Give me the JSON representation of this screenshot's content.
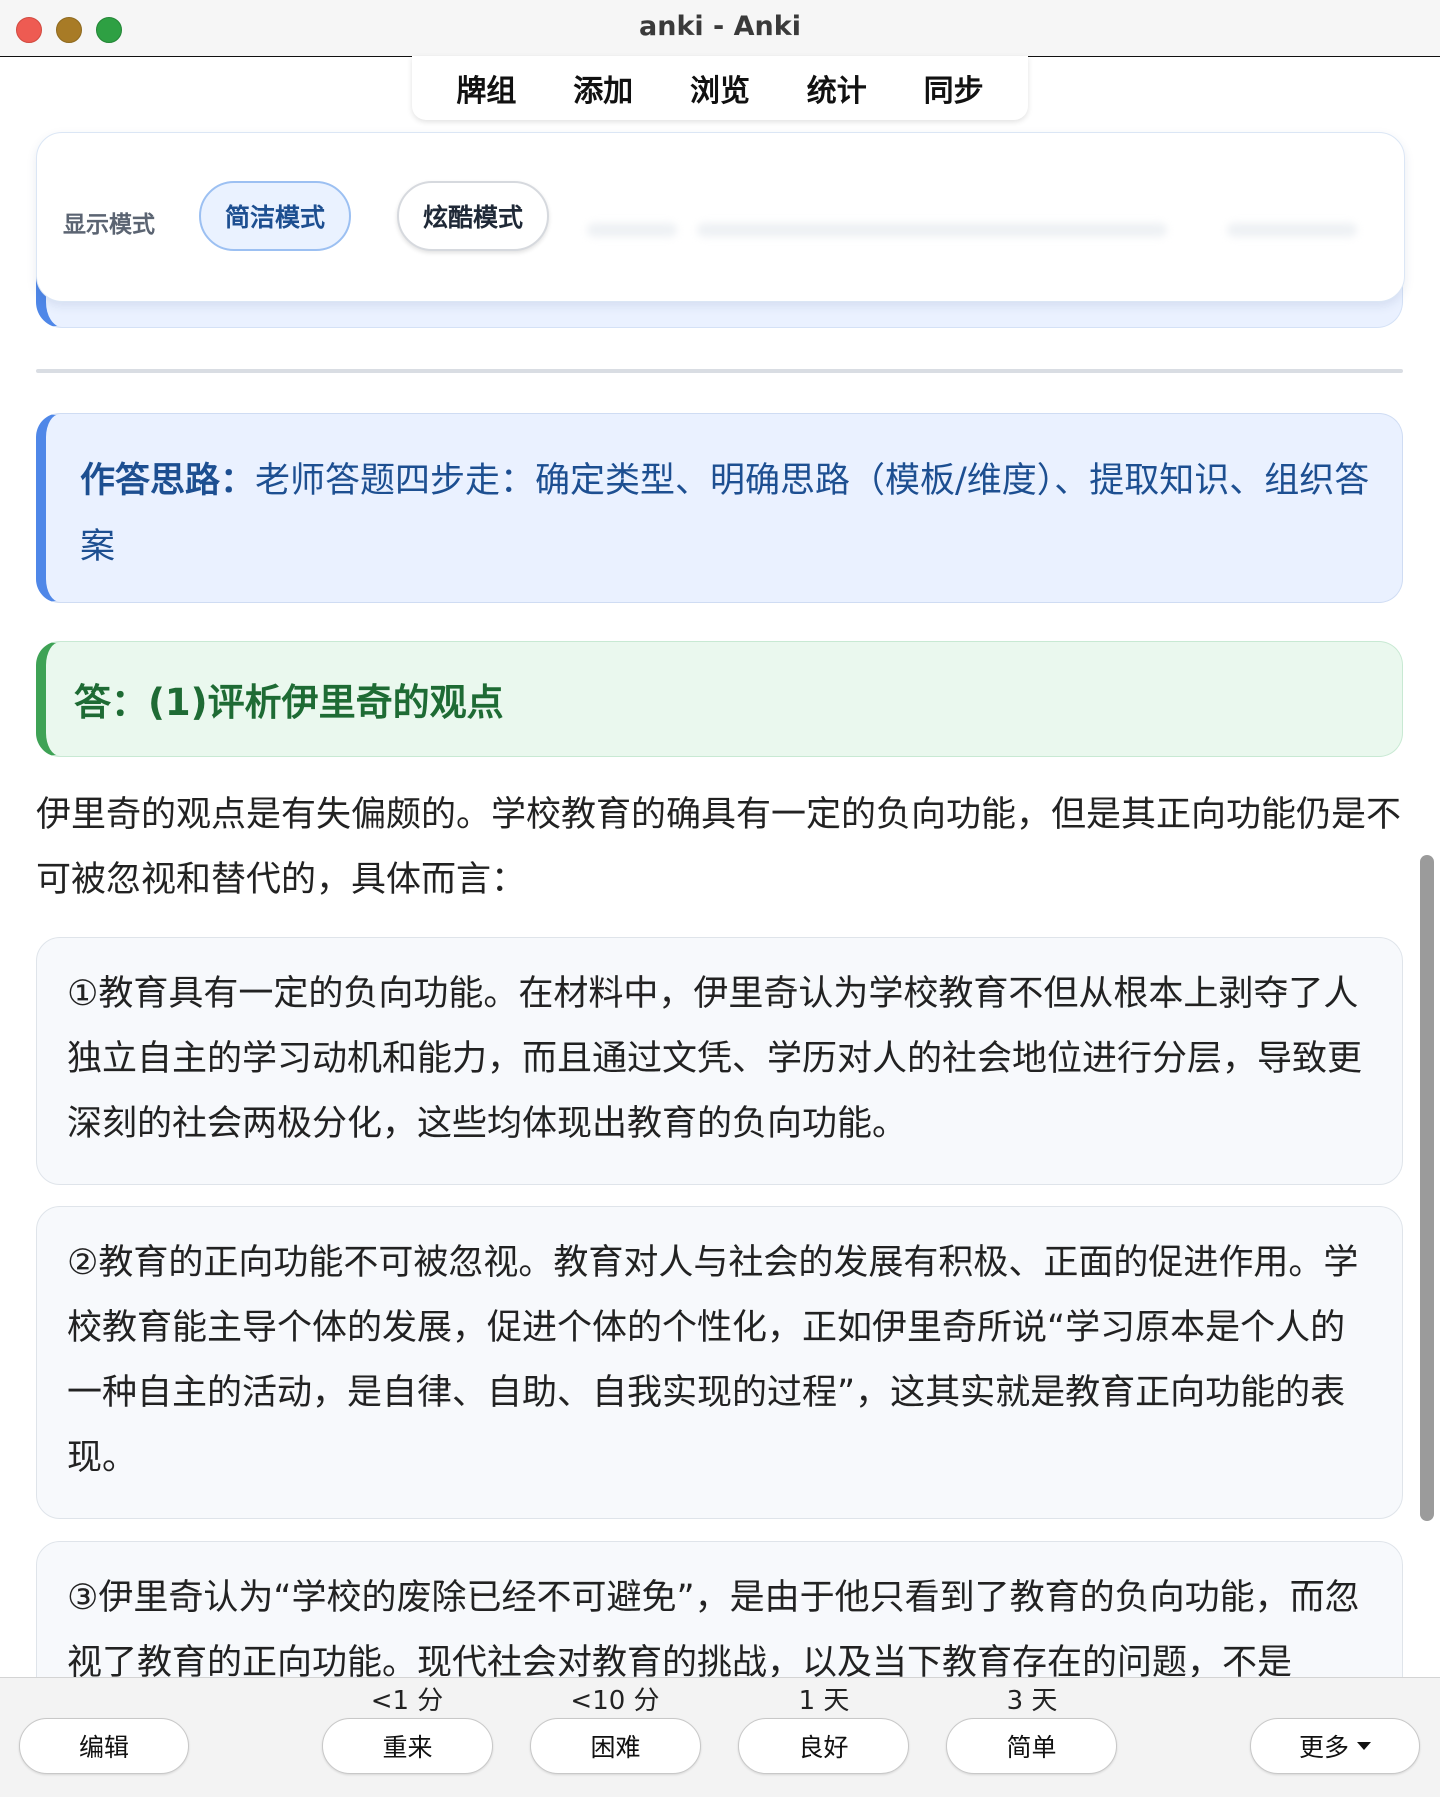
{
  "window": {
    "title": "anki - Anki"
  },
  "nav": {
    "items": [
      "牌组",
      "添加",
      "浏览",
      "统计",
      "同步"
    ]
  },
  "display_mode": {
    "label": "显示模式",
    "simple": "简洁模式",
    "cool": "炫酷模式"
  },
  "idea": {
    "label": "作答思路：",
    "text": "老师答题四步走：确定类型、明确思路（模板/维度）、提取知识、组织答案"
  },
  "answer": {
    "title": "答：(1)评析伊里奇的观点"
  },
  "intro": "伊里奇的观点是有失偏颇的。学校教育的确具有一定的负向功能，但是其正向功能仍是不可被忽视和替代的，具体而言：",
  "points": [
    "①教育具有一定的负向功能。在材料中，伊里奇认为学校教育不但从根本上剥夺了人独立自主的学习动机和能力，而且通过文凭、学历对人的社会地位进行分层，导致更深刻的社会两极分化，这些均体现出教育的负向功能。",
    "②教育的正向功能不可被忽视。教育对人与社会的发展有积极、正面的促进作用。学校教育能主导个体的发展，促进个体的个性化，正如伊里奇所说“学习原本是个人的一种自主的活动，是自律、自助、自我实现的过程”，这其实就是教育正向功能的表现。",
    "③伊里奇认为“学校的废除已经不可避免”，是由于他只看到了教育的负向功能，而忽视了教育的正向功能。现代社会对教育的挑战，以及当下教育存在的问题，不是"
  ],
  "bottom": {
    "edit": "编辑",
    "again": "重来",
    "again_time": "<1 分",
    "hard": "困难",
    "hard_time": "<10 分",
    "good": "良好",
    "good_time": "1 天",
    "easy": "简单",
    "easy_time": "3 天",
    "more": "更多"
  }
}
